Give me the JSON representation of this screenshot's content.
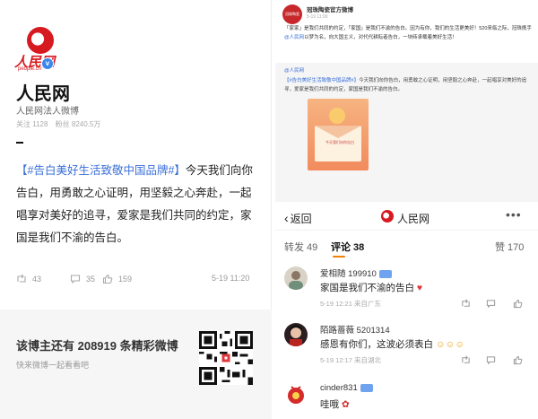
{
  "profile": {
    "logo_text": "人民网",
    "logo_sub": "people.cn",
    "name": "人民网",
    "desc": "人民网法人微博",
    "following": "关注 1128",
    "followers": "粉丝 8240.5万"
  },
  "post": {
    "topic": "【#告白美好生活致敬中国品牌#】",
    "text": "今天我们向你告白，用勇敢之心证明，用坚毅之心奔赴，一起唱享对美好的追寻，爱家是我们共同的约定，家国是我们不渝的告白。",
    "reposts": "43",
    "comments": "35",
    "likes": "159",
    "date": "5-19 11:20"
  },
  "footer": {
    "title": "该博主还有 208919 条精彩微博",
    "subtitle": "快来微博一起看看吧"
  },
  "repost_card": {
    "avatar_text": "冠珠陶瓷",
    "name": "冠珠陶瓷官方微博",
    "time": "5-19 11:00",
    "text_a": "「家家」是我们共同的约定，「家国」是我们不渝的告白。因为有你，我们的生活更美好！520来临之际，冠珠携手",
    "mention": "@人民网",
    "text_b": "以梦为名，向大国主义，对代代耕耘者告白，一块砖承载着美好生活！",
    "rp_name": "@人民网",
    "rp_topic": "【#告白美好生活致敬中国品牌#】",
    "rp_text": "今天我们向你告白，用勇敢之心证明，用坚毅之心奔赴，一起唱享对美好的追寻，爱家是我们共同的约定，家国是我们不渝的告白。",
    "image_text": "今天我们向你告白"
  },
  "comments_view": {
    "back": "返回",
    "title": "人民网",
    "tabs": [
      {
        "label": "转发 49"
      },
      {
        "label": "评论 38"
      },
      {
        "label": "赞 170"
      }
    ],
    "items": [
      {
        "name": "爱相随 199910",
        "text": "家国是我们不渝的告白",
        "meta": "5-19 12:21 来自广东"
      },
      {
        "name": "陌路蔷薇 5201314",
        "text": "感恩有你们，这波必须表白",
        "meta": "5-19 12:17 来自湖北"
      },
      {
        "name": "cinder831",
        "text": "哇哦"
      }
    ]
  },
  "colors": {
    "brand_red": "#d71920",
    "link_blue": "#3a6fd8",
    "tab_accent": "#f27f00"
  }
}
